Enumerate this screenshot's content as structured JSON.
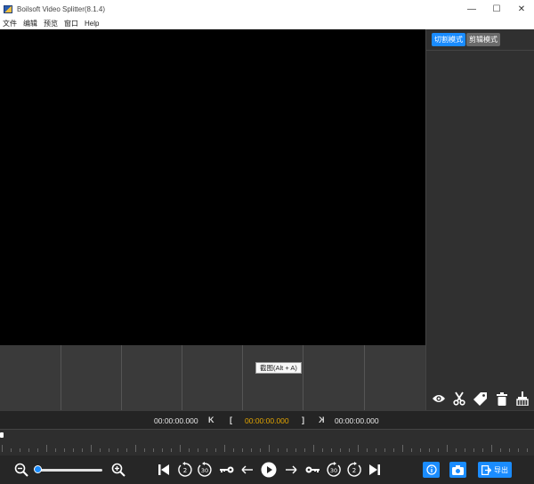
{
  "window": {
    "title": "Boilsoft Video Splitter(8.1.4)",
    "minimize": "—",
    "maximize": "☐",
    "close": "✕"
  },
  "menu": {
    "items": [
      "文件",
      "编辑",
      "预览",
      "窗口",
      "Help"
    ]
  },
  "right_panel": {
    "tabs": [
      {
        "label": "切割模式",
        "active": true
      },
      {
        "label": "剪辑模式",
        "active": false
      }
    ],
    "tools": [
      "eye-icon",
      "scissors-icon",
      "tag-icon",
      "trash-icon",
      "broom-icon"
    ]
  },
  "tooltip": {
    "text": "截图(Alt + A)"
  },
  "time_bar": {
    "current_time": "00:00:00.000",
    "start_marker_symbol": "K",
    "bracket_open": "[",
    "selection_time": "00:00:00.000",
    "bracket_close": "]",
    "end_marker_symbol": "K",
    "end_time": "00:00:00.000",
    "accent_color": "#e2a400"
  },
  "controls": {
    "zoom_level": 0.0,
    "export_label": "导出",
    "accent_color": "#1a8cff"
  }
}
